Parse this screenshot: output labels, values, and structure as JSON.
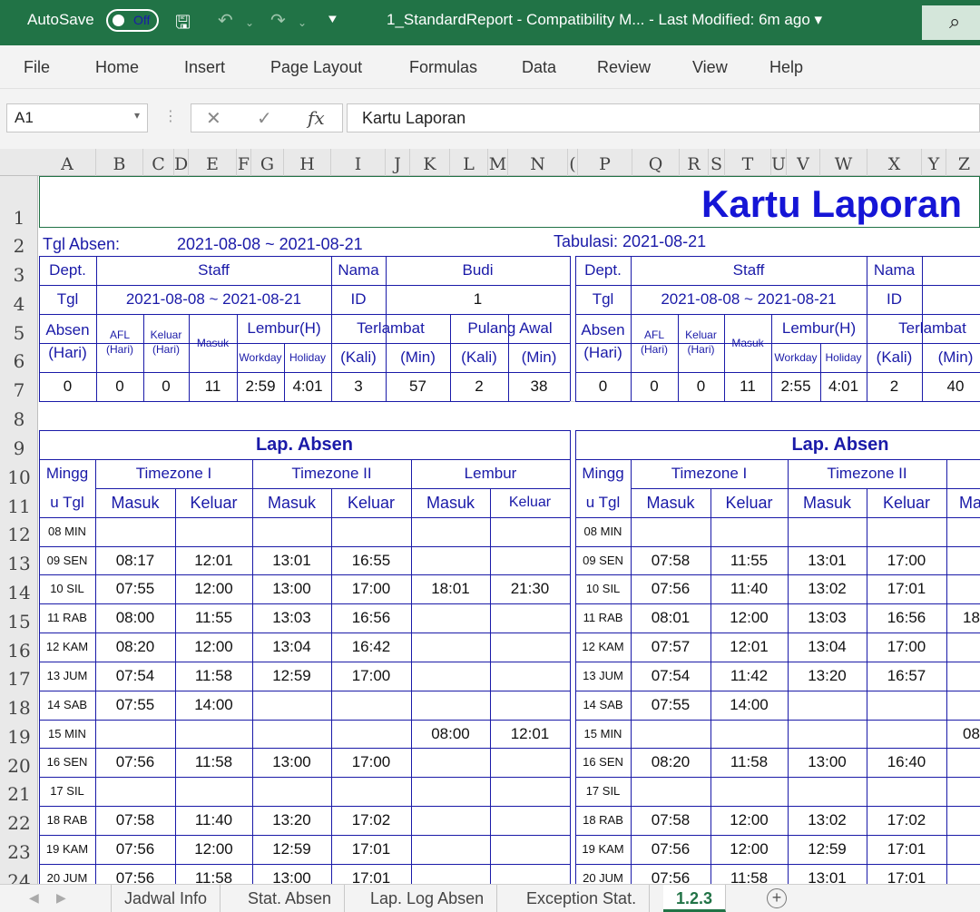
{
  "titlebar": {
    "autosave_label": "AutoSave",
    "autosave_state": "Off",
    "doc_title": "1_StandardReport  -  Compatibility M...  -  Last Modified: 6m ago  ▾"
  },
  "menu": [
    "File",
    "Home",
    "Insert",
    "Page Layout",
    "Formulas",
    "Data",
    "Review",
    "View",
    "Help"
  ],
  "formula_bar": {
    "name_box": "A1",
    "formula": "Kartu Laporan",
    "fx": "fx"
  },
  "columns": [
    "A",
    "B",
    "C",
    "D",
    "E",
    "F",
    "G",
    "H",
    "I",
    "J",
    "K",
    "L",
    "M",
    "N",
    "(",
    "P",
    "Q",
    "R",
    "S",
    "T",
    "U",
    "V",
    "W",
    "X",
    "Y",
    "Z"
  ],
  "rows": [
    "1",
    "2",
    "3",
    "4",
    "5",
    "6",
    "7",
    "8",
    "9",
    "10",
    "11",
    "12",
    "13",
    "14",
    "15",
    "16",
    "17",
    "18",
    "19",
    "20",
    "21",
    "22",
    "23",
    "24"
  ],
  "report": {
    "title": "Kartu Laporan",
    "tgl_absen_label": "Tgl Absen:",
    "tgl_absen_value": "2021-08-08 ~ 2021-08-21",
    "tabulasi": "Tabulasi: 2021-08-21",
    "hdr": {
      "dept": "Dept.",
      "staff": "Staff",
      "nama": "Nama",
      "tgl": "Tgl",
      "id": "ID",
      "absen": "Absen",
      "hari": "(Hari)",
      "afl": "AFL",
      "keluar": "Keluar",
      "masuk": "Masuk",
      "lembur_h": "Lembur(H)",
      "workday": "Workday",
      "holiday": "Holiday",
      "terlambat": "Terlambat",
      "pulang_awal": "Pulang Awal",
      "kali": "(Kali)",
      "min": "(Min)",
      "lap_absen": "Lap. Absen",
      "mingg": "Mingg",
      "u_tgl": "u Tgl",
      "tz1": "Timezone I",
      "tz2": "Timezone II",
      "lembur": "Lembur"
    },
    "left": {
      "nama": "Budi",
      "tgl_range": "2021-08-08 ~ 2021-08-21",
      "id": "1",
      "summary": [
        "0",
        "0",
        "0",
        "11",
        "2:59",
        "4:01",
        "3",
        "57",
        "2",
        "38"
      ]
    },
    "right": {
      "tgl_range": "2021-08-08 ~ 2021-08-21",
      "summary": [
        "0",
        "0",
        "0",
        "11",
        "2:55",
        "4:01",
        "2",
        "40"
      ]
    },
    "days": [
      "08 MIN",
      "09 SEN",
      "10 SIL",
      "11 RAB",
      "12 KAM",
      "13 JUM",
      "14 SAB",
      "15 MIN",
      "16 SEN",
      "17 SIL",
      "18 RAB",
      "19 KAM",
      "20 JUM"
    ],
    "left_times": [
      [
        "",
        "",
        "",
        "",
        "",
        ""
      ],
      [
        "08:17",
        "12:01",
        "13:01",
        "16:55",
        "",
        ""
      ],
      [
        "07:55",
        "12:00",
        "13:00",
        "17:00",
        "18:01",
        "21:30"
      ],
      [
        "08:00",
        "11:55",
        "13:03",
        "16:56",
        "",
        ""
      ],
      [
        "08:20",
        "12:00",
        "13:04",
        "16:42",
        "",
        ""
      ],
      [
        "07:54",
        "11:58",
        "12:59",
        "17:00",
        "",
        ""
      ],
      [
        "07:55",
        "14:00",
        "",
        "",
        "",
        ""
      ],
      [
        "",
        "",
        "",
        "",
        "08:00",
        "12:01"
      ],
      [
        "07:56",
        "11:58",
        "13:00",
        "17:00",
        "",
        ""
      ],
      [
        "",
        "",
        "",
        "",
        "",
        ""
      ],
      [
        "07:58",
        "11:40",
        "13:20",
        "17:02",
        "",
        ""
      ],
      [
        "07:56",
        "12:00",
        "12:59",
        "17:01",
        "",
        ""
      ],
      [
        "07:56",
        "11:58",
        "13:00",
        "17:01",
        "",
        ""
      ]
    ],
    "right_times": [
      [
        "",
        "",
        "",
        "",
        ""
      ],
      [
        "07:58",
        "11:55",
        "13:01",
        "17:00",
        ""
      ],
      [
        "07:56",
        "11:40",
        "13:02",
        "17:01",
        ""
      ],
      [
        "08:01",
        "12:00",
        "13:03",
        "16:56",
        "18"
      ],
      [
        "07:57",
        "12:01",
        "13:04",
        "17:00",
        ""
      ],
      [
        "07:54",
        "11:42",
        "13:20",
        "16:57",
        ""
      ],
      [
        "07:55",
        "14:00",
        "",
        "",
        ""
      ],
      [
        "",
        "",
        "",
        "",
        "08"
      ],
      [
        "08:20",
        "11:58",
        "13:00",
        "16:40",
        ""
      ],
      [
        "",
        "",
        "",
        "",
        ""
      ],
      [
        "07:58",
        "12:00",
        "13:02",
        "17:02",
        ""
      ],
      [
        "07:56",
        "12:00",
        "12:59",
        "17:01",
        ""
      ],
      [
        "07:56",
        "11:58",
        "13:01",
        "17:01",
        ""
      ]
    ],
    "right_partial_masuk": "Ma"
  },
  "sheet_tabs": [
    "Jadwal Info",
    "Stat. Absen",
    "Lap. Log Absen",
    "Exception Stat.",
    "1.2.3"
  ],
  "active_tab": "1.2.3",
  "colors": {
    "excel_green": "#217346",
    "report_blue": "#1a1aa8",
    "title_blue": "#1515d6"
  }
}
